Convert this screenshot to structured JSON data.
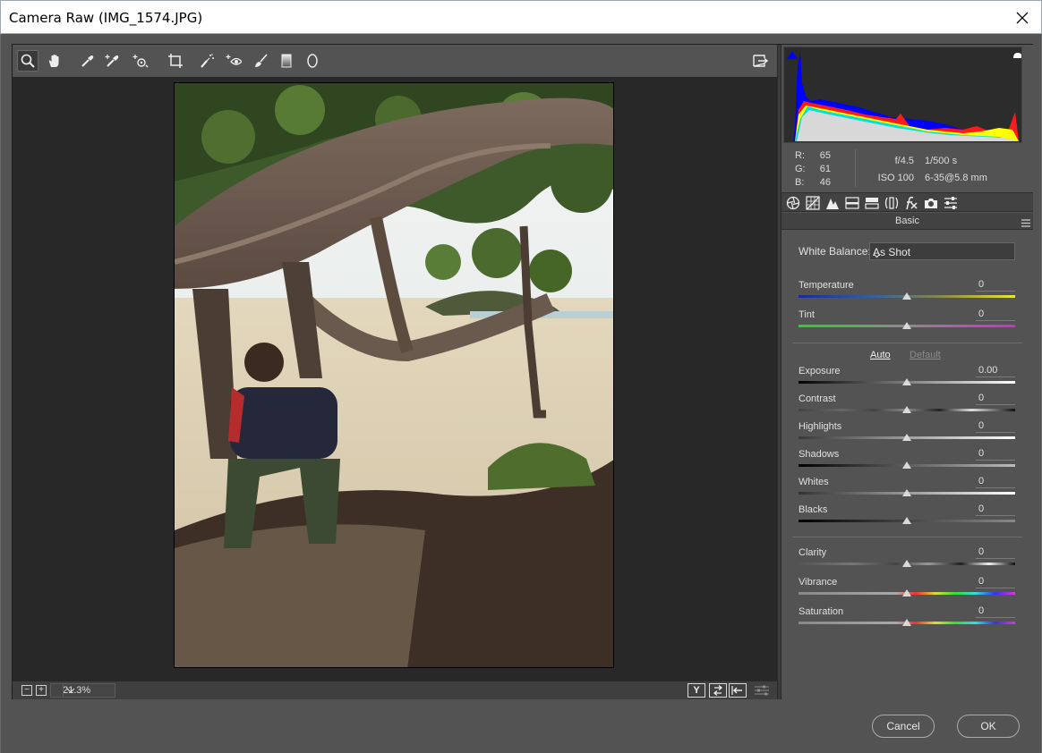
{
  "window": {
    "title": "Camera Raw (IMG_1574.JPG)"
  },
  "toolbar": {
    "tools": [
      "zoom-tool",
      "hand-tool",
      "white-balance-tool",
      "color-sampler-tool",
      "targeted-adjustment-tool",
      "crop-tool",
      "spot-removal-tool",
      "red-eye-removal-tool",
      "adjustment-brush",
      "graduated-filter",
      "radial-filter"
    ],
    "active_tool": "zoom-tool"
  },
  "bottom": {
    "zoom": "21.3%",
    "zoom_out": "−",
    "zoom_in": "+",
    "view_y": "Y"
  },
  "info": {
    "r_label": "R:",
    "r_value": "65",
    "g_label": "G:",
    "g_value": "61",
    "b_label": "B:",
    "b_value": "46",
    "aperture": "f/4.5",
    "shutter": "1/500 s",
    "iso": "ISO 100",
    "lens": "6-35@5.8 mm"
  },
  "panel": {
    "title": "Basic",
    "white_balance_label": "White Balance:",
    "white_balance_value": "As Shot",
    "auto_label": "Auto",
    "default_label": "Default",
    "sliders": [
      {
        "label": "Temperature",
        "value": "0"
      },
      {
        "label": "Tint",
        "value": "0"
      },
      {
        "label": "Exposure",
        "value": "0.00"
      },
      {
        "label": "Contrast",
        "value": "0"
      },
      {
        "label": "Highlights",
        "value": "0"
      },
      {
        "label": "Shadows",
        "value": "0"
      },
      {
        "label": "Whites",
        "value": "0"
      },
      {
        "label": "Blacks",
        "value": "0"
      },
      {
        "label": "Clarity",
        "value": "0"
      },
      {
        "label": "Vibrance",
        "value": "0"
      },
      {
        "label": "Saturation",
        "value": "0"
      }
    ]
  },
  "footer": {
    "cancel": "Cancel",
    "ok": "OK"
  }
}
